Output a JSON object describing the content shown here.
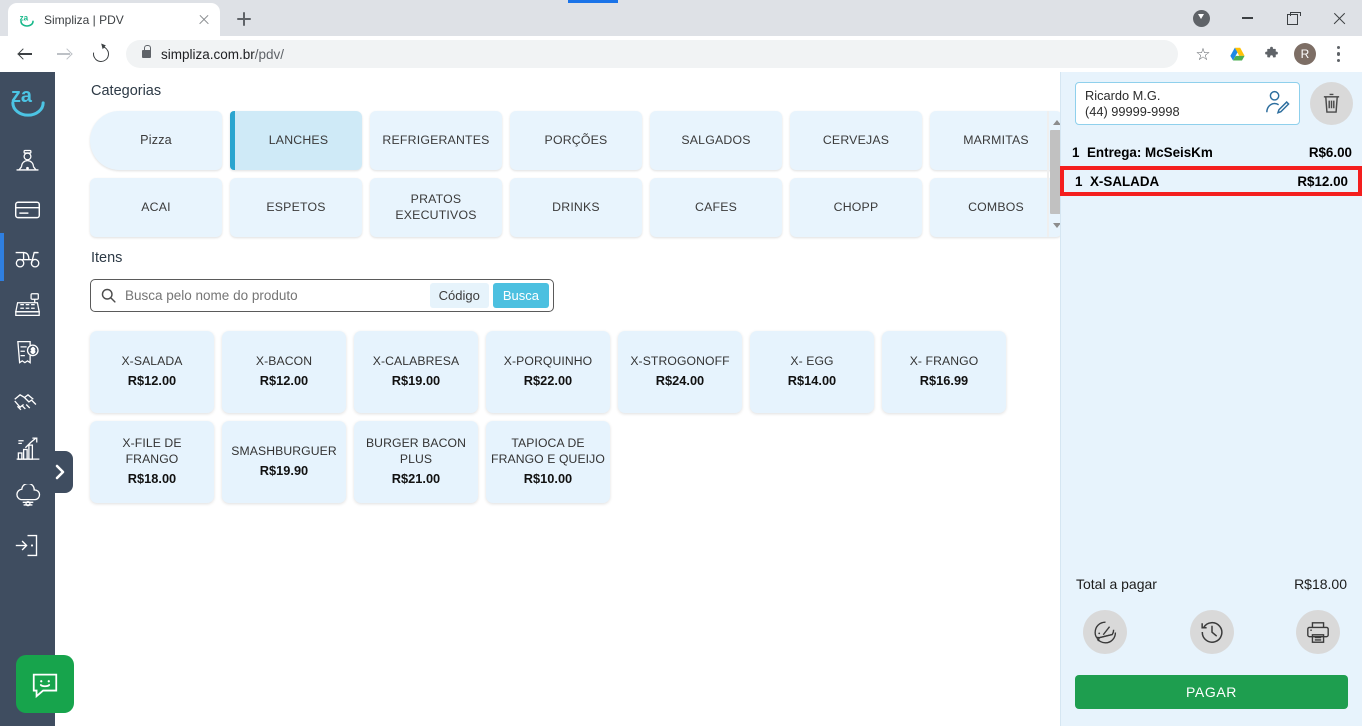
{
  "browser": {
    "tab": {
      "title": "Simpliza | PDV",
      "favicon": "za-logo-icon"
    },
    "newtab_label": "+",
    "url_secure": "simpliza.com.br",
    "url_path": "/pdv/",
    "profile_initial": "R",
    "window": {
      "minimize": "—",
      "maximize": "❐",
      "close": "✕"
    }
  },
  "sidebar": {
    "logo": "za-logo-icon",
    "items": [
      {
        "icon": "waiter-icon",
        "active": false
      },
      {
        "icon": "card-icon",
        "active": false
      },
      {
        "icon": "delivery-scooter-icon",
        "active": true
      },
      {
        "icon": "cash-register-icon",
        "active": false
      },
      {
        "icon": "invoice-money-icon",
        "active": false
      },
      {
        "icon": "handshake-icon",
        "active": false
      },
      {
        "icon": "growth-chart-icon",
        "active": false
      },
      {
        "icon": "cloud-settings-icon",
        "active": false
      },
      {
        "icon": "logout-icon",
        "active": false
      }
    ],
    "expand_icon": "chevron-right-icon",
    "chat_icon": "chat-smiley-icon"
  },
  "main": {
    "categories_tab": "Categorias",
    "items_tab": "Itens",
    "categories": [
      {
        "label": "Pizza",
        "selected": false,
        "first": true
      },
      {
        "label": "LANCHES",
        "selected": true
      },
      {
        "label": "REFRIGERANTES",
        "selected": false
      },
      {
        "label": "PORÇÕES",
        "selected": false
      },
      {
        "label": "SALGADOS",
        "selected": false
      },
      {
        "label": "CERVEJAS",
        "selected": false
      },
      {
        "label": "MARMITAS",
        "selected": false
      },
      {
        "label": "ACAI",
        "selected": false
      },
      {
        "label": "ESPETOS",
        "selected": false
      },
      {
        "label": "PRATOS EXECUTIVOS",
        "selected": false
      },
      {
        "label": "DRINKS",
        "selected": false
      },
      {
        "label": "CAFES",
        "selected": false
      },
      {
        "label": "CHOPP",
        "selected": false
      },
      {
        "label": "COMBOS",
        "selected": false
      }
    ],
    "search": {
      "placeholder": "Busca pelo nome do produto",
      "value": "",
      "icon": "search-icon",
      "codigo_label": "Código",
      "busca_label": "Busca"
    },
    "products": [
      {
        "name": "X-SALADA",
        "price": "R$12.00"
      },
      {
        "name": "X-BACON",
        "price": "R$12.00"
      },
      {
        "name": "X-CALABRESA",
        "price": "R$19.00"
      },
      {
        "name": "X-PORQUINHO",
        "price": "R$22.00"
      },
      {
        "name": "X-STROGONOFF",
        "price": "R$24.00"
      },
      {
        "name": "X- EGG",
        "price": "R$14.00"
      },
      {
        "name": "X- FRANGO",
        "price": "R$16.99"
      },
      {
        "name": "X-FILE DE FRANGO",
        "price": "R$18.00"
      },
      {
        "name": "SMASHBURGUER",
        "price": "R$19.90"
      },
      {
        "name": "BURGER BACON PLUS",
        "price": "R$21.00"
      },
      {
        "name": "TAPIOCA DE FRANGO E QUEIJO",
        "price": "R$10.00"
      }
    ]
  },
  "panel": {
    "customer": {
      "name": "Ricardo M.G.",
      "phone": "(44) 99999-9998",
      "edit_icon": "person-edit-icon"
    },
    "delete_icon": "trash-icon",
    "lines": [
      {
        "qty": "1",
        "name": "Entrega: McSeisKm",
        "price": "R$6.00",
        "highlighted": false
      },
      {
        "qty": "1",
        "name": "X-SALADA",
        "price": "R$12.00",
        "highlighted": true
      }
    ],
    "total_label": "Total a pagar",
    "total_value": "R$18.00",
    "actions": [
      {
        "icon": "helmet-icon"
      },
      {
        "icon": "clock-history-icon"
      },
      {
        "icon": "printer-icon"
      }
    ],
    "pay_label": "PAGAR"
  },
  "colors": {
    "accent": "#4cb8d4",
    "sidebar": "#3f4d60",
    "panel_bg": "#e7f3fc",
    "tile_bg": "#e6f3fd",
    "selected_tile": "#cfeaf7",
    "highlight_border": "#f41e1e",
    "pay_green": "#1e9e4f",
    "active_blue": "#2f7fe0"
  }
}
